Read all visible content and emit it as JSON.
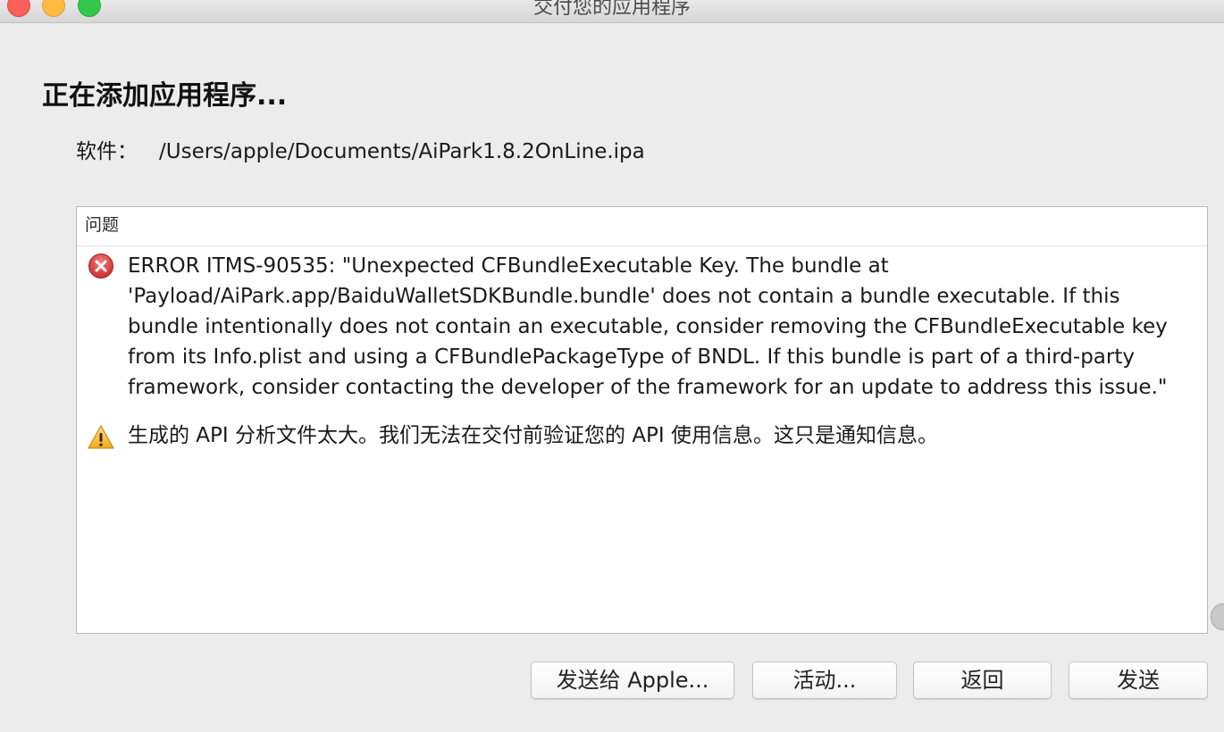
{
  "window": {
    "title": "交付您的应用程序"
  },
  "heading": "正在添加应用程序...",
  "software": {
    "label": "软件：",
    "path": "/Users/apple/Documents/AiPark1.8.2OnLine.ipa"
  },
  "issues": {
    "header": "问题",
    "items": [
      {
        "type": "error",
        "icon": "error-icon",
        "text": "ERROR ITMS-90535: \"Unexpected CFBundleExecutable Key. The bundle at 'Payload/AiPark.app/BaiduWalletSDKBundle.bundle' does not contain a bundle executable. If this bundle intentionally does not contain an executable, consider removing the CFBundleExecutable key from its Info.plist and using a CFBundlePackageType of BNDL. If this bundle is part of a third-party framework, consider contacting the developer of the framework for an update to address this issue.\""
      },
      {
        "type": "warning",
        "icon": "warning-icon",
        "text": "生成的 API 分析文件太大。我们无法在交付前验证您的 API 使用信息。这只是通知信息。"
      }
    ]
  },
  "buttons": {
    "send_to_apple": "发送给 Apple...",
    "activity": "活动...",
    "back": "返回",
    "send": "发送"
  },
  "colors": {
    "window_bg": "#ececec",
    "panel_bg": "#ffffff",
    "error_red": "#d63b3b",
    "warning_yellow": "#f5b82e"
  }
}
